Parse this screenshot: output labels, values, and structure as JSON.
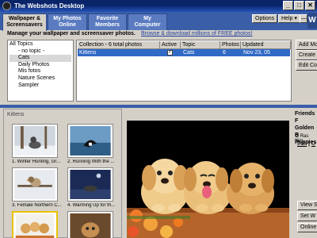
{
  "window": {
    "title": "The Webshots Desktop",
    "controls": [
      "_",
      "□",
      "✕"
    ]
  },
  "tabs": [
    {
      "label_line1": "Wallpaper &",
      "label_line2": "Screensavers"
    },
    {
      "label_line1": "My Photos",
      "label_line2": "Online"
    },
    {
      "label_line1": "Favorite",
      "label_line2": "Members"
    },
    {
      "label_line1": "My",
      "label_line2": "Computer"
    }
  ],
  "toolbar": {
    "options": "Options",
    "help": "Help ▾",
    "min": "—",
    "logo": "W"
  },
  "manage": {
    "text": "Manage your wallpaper and screensaver photos.",
    "browse_link": "Browse & download millions of FREE photos!"
  },
  "topics": {
    "items": [
      "All Topics",
      "- no topic -",
      "Cats",
      "Daily Photos",
      "Mis fotos",
      "Nature Scenes",
      "Sampler"
    ]
  },
  "collection": {
    "headers": [
      "Collection - 6 total photos",
      "Active",
      "Topic",
      "Photos",
      "Updated"
    ],
    "rows": [
      {
        "name": "Kittens",
        "active": "✓",
        "topic": "Cats",
        "photos": "6",
        "updated": "Nov 23, 05"
      }
    ]
  },
  "side_buttons": [
    "Add Mo",
    "Create",
    "Edit Co"
  ],
  "thumbs": {
    "label": "Kittens",
    "captions": [
      "1. Winter Hunting, Gr...",
      "2. Running With the ...",
      "3. Female Northern C...",
      "4. Warming Up for th...",
      "",
      ""
    ]
  },
  "info": {
    "title_line1": "Friends F",
    "title_line2": "Golden R",
    "title_line3": "Puppies",
    "rating": "✪ Ras Kim",
    "edit": "Edit",
    "sep": "|",
    "other": "D"
  },
  "right_buttons": [
    "View S",
    "Set W",
    "Online"
  ]
}
